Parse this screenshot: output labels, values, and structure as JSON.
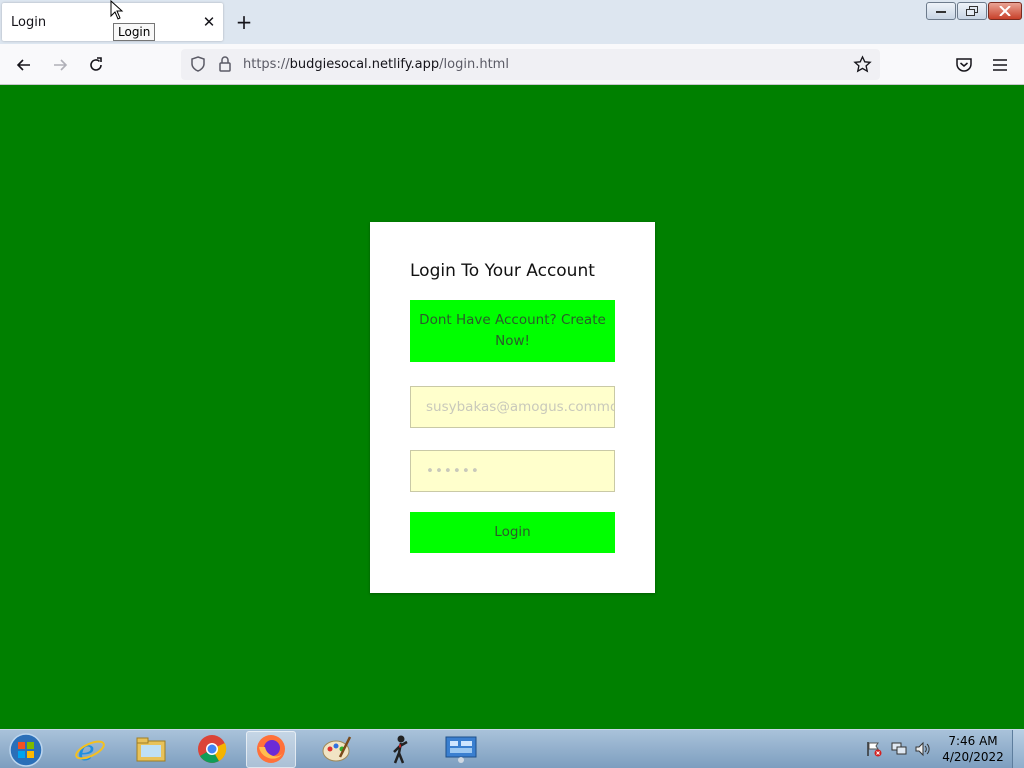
{
  "browser": {
    "tab_title": "Login",
    "tooltip": "Login",
    "url_prefix": "https://",
    "url_host": "budgiesocal.netlify.app",
    "url_path": "/login.html"
  },
  "page": {
    "background_color": "#008000",
    "accent_color": "#00ff00",
    "card_title": "Login To Your Account",
    "create_account_label": "Dont Have Account? Create Now!",
    "email_placeholder": "susybakas@amogus.commo",
    "password_placeholder": "••••••",
    "login_label": "Login"
  },
  "taskbar": {
    "time": "7:46 AM",
    "date": "4/20/2022",
    "apps": [
      "internet-explorer-icon",
      "file-explorer-icon",
      "chrome-icon",
      "firefox-icon",
      "paint-icon",
      "stick-figure-app-icon",
      "control-panel-icon"
    ]
  }
}
